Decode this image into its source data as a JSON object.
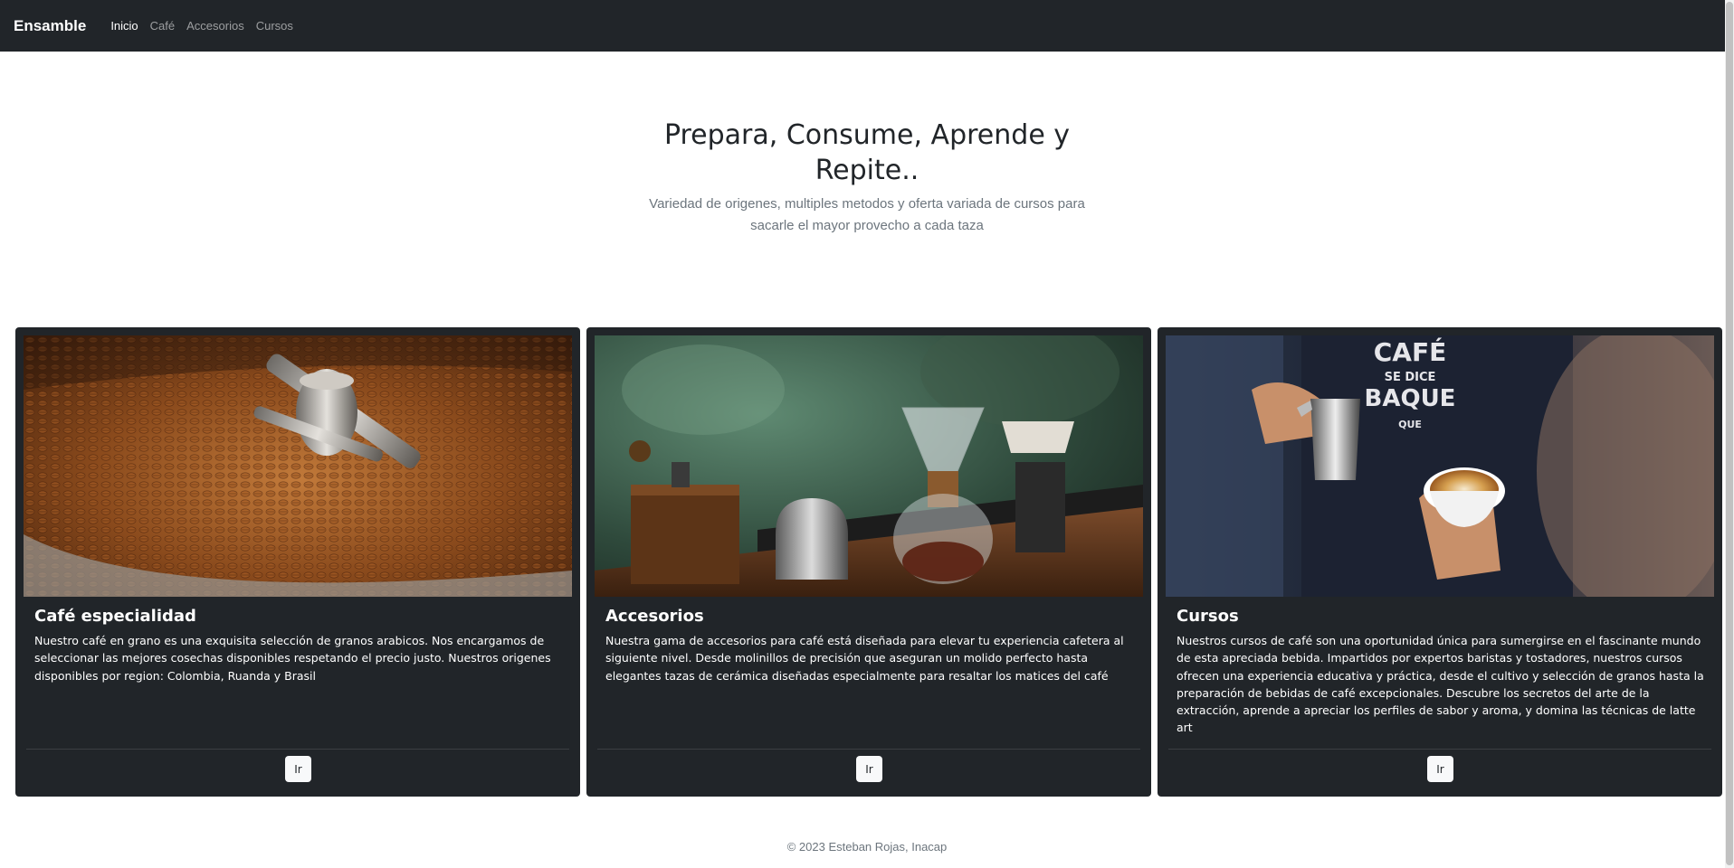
{
  "nav": {
    "brand": "Ensamble",
    "links": [
      "Inicio",
      "Café",
      "Accesorios",
      "Cursos"
    ]
  },
  "hero": {
    "title": "Prepara, Consume, Aprende y Repite..",
    "subtitle": "Variedad de origenes, multiples metodos y oferta variada de cursos para sacarle el mayor provecho a cada taza"
  },
  "cards": [
    {
      "image": "coffee-roaster-beans-photo",
      "title": "Café especialidad",
      "text": "Nuestro café en grano es una exquisita selección de granos arabicos. Nos encargamos de seleccionar las mejores cosechas disponibles respetando el precio justo. Nuestros origenes disponibles por region: Colombia, Ruanda y Brasil",
      "button": "Ir"
    },
    {
      "image": "coffee-accessories-photo",
      "title": "Accesorios",
      "text": "Nuestra gama de accesorios para café está diseñada para elevar tu experiencia cafetera al siguiente nivel. Desde molinillos de precisión que aseguran un molido perfecto hasta elegantes tazas de cerámica diseñadas especialmente para resaltar los matices del café",
      "button": "Ir"
    },
    {
      "image": "barista-latte-art-photo",
      "title": "Cursos",
      "text": "Nuestros cursos de café son una oportunidad única para sumergirse en el fascinante mundo de esta apreciada bebida. Impartidos por expertos baristas y tostadores, nuestros cursos ofrecen una experiencia educativa y práctica, desde el cultivo y selección de granos hasta la preparación de bebidas de café excepcionales. Descubre los secretos del arte de la extracción, aprende a apreciar los perfiles de sabor y aroma, y domina las técnicas de latte art",
      "button": "Ir"
    }
  ],
  "apron_text": [
    "CAFÉ",
    "SE DICE",
    "BAQUE",
    "QUE"
  ],
  "footer": "© 2023 Esteban Rojas, Inacap",
  "colors": {
    "dark": "#212529",
    "muted": "#6c757d",
    "light": "#f8f9fa"
  }
}
